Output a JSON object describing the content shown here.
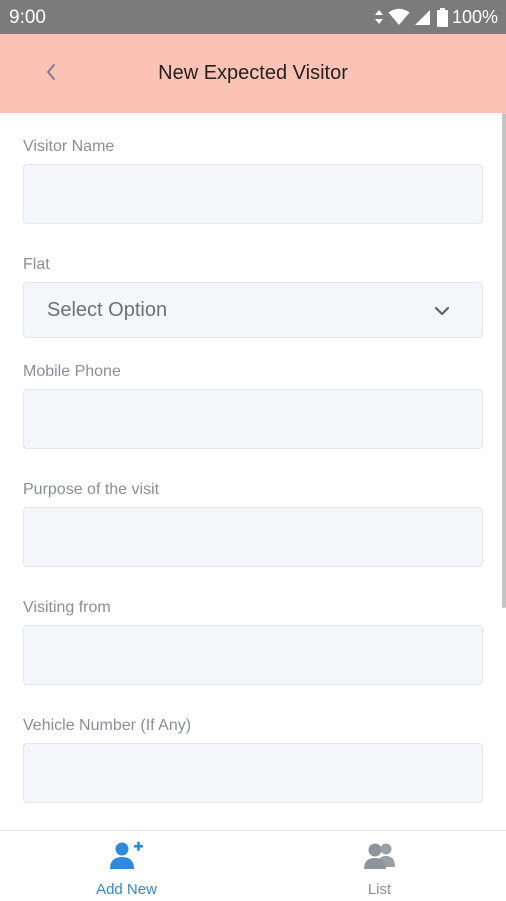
{
  "status_bar": {
    "time": "9:00",
    "battery": "100%",
    "icons": [
      "data-arrows-icon",
      "wifi-icon",
      "cell-signal-icon",
      "battery-icon"
    ]
  },
  "app_bar": {
    "title": "New Expected Visitor",
    "background": "#fcc3b4",
    "back_icon": "chevron-left-icon"
  },
  "form": {
    "visitor_name": {
      "label": "Visitor Name",
      "value": "",
      "placeholder": ""
    },
    "flat": {
      "label": "Flat",
      "selected": "Select Option"
    },
    "mobile_phone": {
      "label": "Mobile Phone",
      "value": "",
      "placeholder": ""
    },
    "purpose": {
      "label": "Purpose of the visit",
      "value": "",
      "placeholder": ""
    },
    "visiting_from": {
      "label": "Visiting from",
      "value": "",
      "placeholder": ""
    },
    "vehicle_number": {
      "label": "Vehicle Number (If Any)",
      "value": "",
      "placeholder": ""
    }
  },
  "bottom_nav": {
    "items": [
      {
        "label": "Add New",
        "icon": "add-user-icon",
        "active": true,
        "color": "#2d8ae0"
      },
      {
        "label": "List",
        "icon": "users-icon",
        "active": false,
        "color": "#8b8f98"
      }
    ]
  }
}
